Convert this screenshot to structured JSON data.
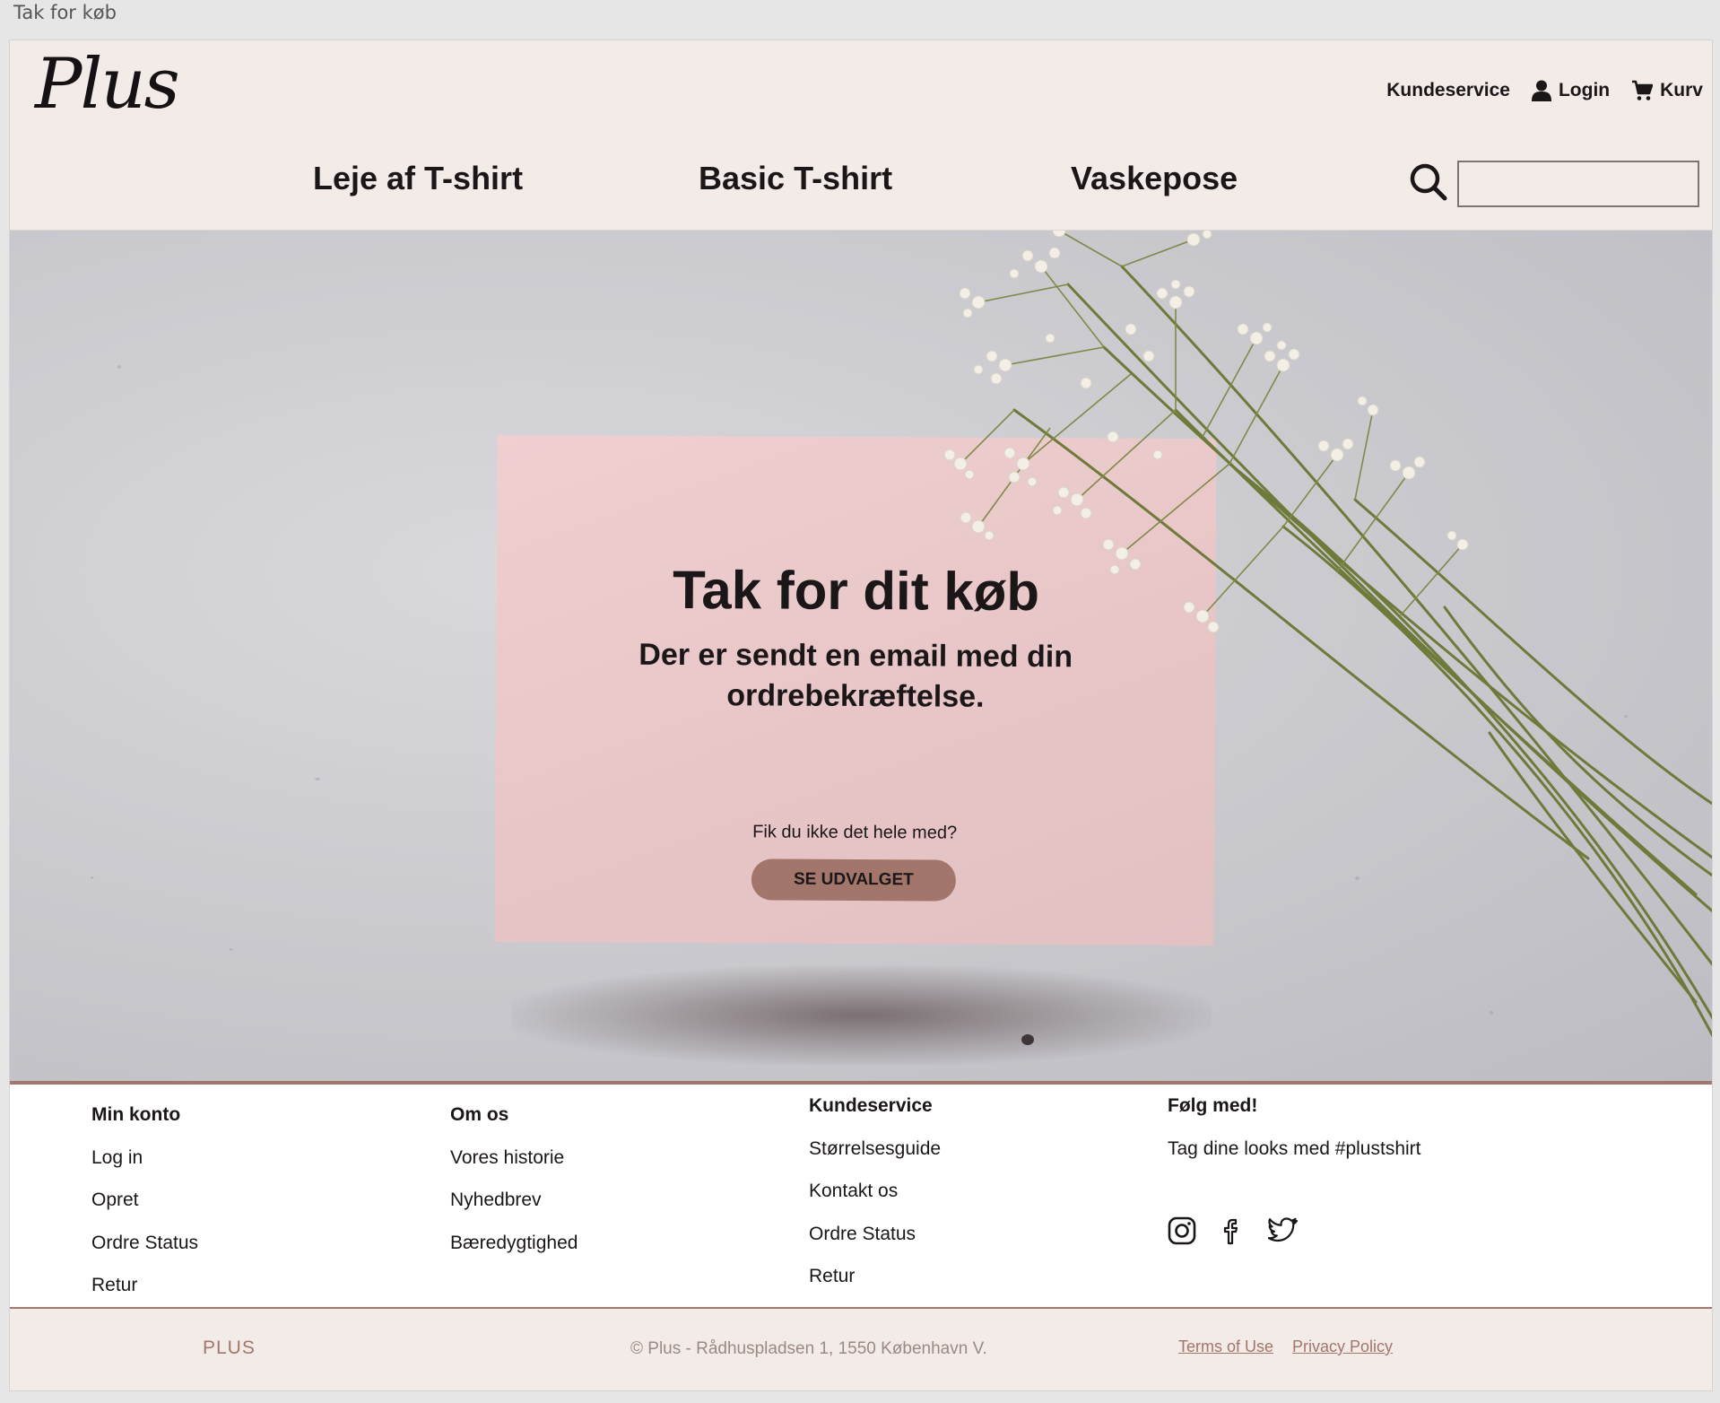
{
  "window": {
    "title": "Tak for køb"
  },
  "header": {
    "logo": "Plus",
    "util_nav": {
      "customer_service": "Kundeservice",
      "login": "Login",
      "cart": "Kurv"
    },
    "main_nav": [
      "Leje af T-shirt",
      "Basic T-shirt",
      "Vaskepose"
    ],
    "search": {
      "value": "",
      "placeholder": ""
    }
  },
  "hero": {
    "title": "Tak for dit køb",
    "subtitle": "Der er sendt en email med din ordrebekræftelse.",
    "question": "Fik du ikke det hele med?",
    "button": "SE UDVALGET"
  },
  "footer": {
    "columns": [
      {
        "heading": "Min konto",
        "links": [
          "Log in",
          "Opret",
          "Ordre Status",
          "Retur"
        ]
      },
      {
        "heading": "Om os",
        "links": [
          "Vores historie",
          "Nyhedbrev",
          "Bæredygtighed"
        ]
      },
      {
        "heading": "Kundeservice",
        "links": [
          "Størrelsesguide",
          "Kontakt os",
          "Ordre Status",
          "Retur"
        ]
      },
      {
        "heading": "Følg med!",
        "text": "Tag dine looks med #plustshirt",
        "social_icons": [
          "instagram-icon",
          "facebook-icon",
          "twitter-icon"
        ]
      }
    ]
  },
  "bottom_bar": {
    "brand": "PLUS",
    "copyright": "© Plus - Rådhuspladsen 1, 1550 København V.",
    "terms": "Terms of Use",
    "privacy": "Privacy Policy"
  },
  "colors": {
    "header_bg": "#f3ebe7",
    "accent": "#a3766b",
    "card_pink": "#e8c6c7",
    "text_dark": "#1b1719"
  }
}
